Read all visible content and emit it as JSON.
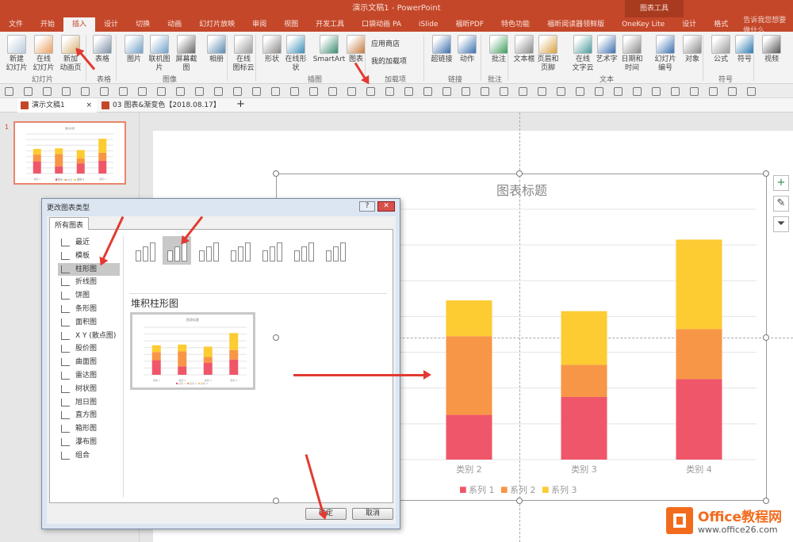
{
  "window": {
    "title": "演示文稿1 - PowerPoint",
    "context_tab": "图表工具"
  },
  "tabs": [
    "文件",
    "开始",
    "插入",
    "设计",
    "切换",
    "动画",
    "幻灯片放映",
    "审阅",
    "视图",
    "开发工具",
    "口袋动画 PA",
    "iSlide",
    "福昕PDF",
    "特色功能",
    "福昕阅读器领鲜版",
    "OneKey Lite",
    "设计",
    "格式"
  ],
  "tell_me": "告诉我您想要做什么",
  "ribbon": {
    "buttons": [
      "新建\n幻灯片",
      "在线\n幻灯片",
      "新加\n动画页",
      "表格",
      "图片",
      "联机图片",
      "屏幕截图",
      "相册",
      "在线\n图标云",
      "形状",
      "在线形状",
      "SmartArt",
      "图表",
      "超链接",
      "动作",
      "批注",
      "文本框",
      "页眉和页脚",
      "在线\n文字云",
      "艺术字",
      "日期和时间",
      "幻灯片\n编号",
      "对象",
      "公式",
      "符号",
      "视频"
    ],
    "small": [
      "应用商店",
      "我的加载项"
    ],
    "groups": [
      "幻灯片",
      "表格",
      "图像",
      "插图",
      "加载项",
      "链接",
      "批注",
      "文本",
      "符号"
    ]
  },
  "doc_tabs": [
    "演示文稿1",
    "03 图表&渐变色【2018.08.17】"
  ],
  "slide_number": "1",
  "dialog": {
    "title": "更改图表类型",
    "tab": "所有图表",
    "types": [
      "最近",
      "模板",
      "柱形图",
      "折线图",
      "饼图",
      "条形图",
      "面积图",
      "X Y (散点图)",
      "股价图",
      "曲面图",
      "雷达图",
      "树状图",
      "旭日图",
      "直方图",
      "箱形图",
      "瀑布图",
      "组合"
    ],
    "selected_type": "柱形图",
    "subtype_title": "堆积柱形图",
    "ok": "确定",
    "cancel": "取消"
  },
  "chart_data": {
    "type": "bar",
    "stacked": true,
    "title": "图表标题",
    "categories": [
      "类别 1",
      "类别 2",
      "类别 3",
      "类别 4"
    ],
    "series": [
      {
        "name": "系列 1",
        "values": [
          4.3,
          2.5,
          3.5,
          4.5
        ],
        "color": "#f0566a"
      },
      {
        "name": "系列 2",
        "values": [
          2.4,
          4.4,
          1.8,
          2.8
        ],
        "color": "#f79646"
      },
      {
        "name": "系列 3",
        "values": [
          2,
          2,
          3,
          5
        ],
        "color": "#fdcb32"
      }
    ],
    "ylim": [
      0,
      14
    ],
    "grid": true,
    "legend": "bottom"
  },
  "watermark": {
    "brand": "Office教程网",
    "url": "www.office26.com"
  }
}
